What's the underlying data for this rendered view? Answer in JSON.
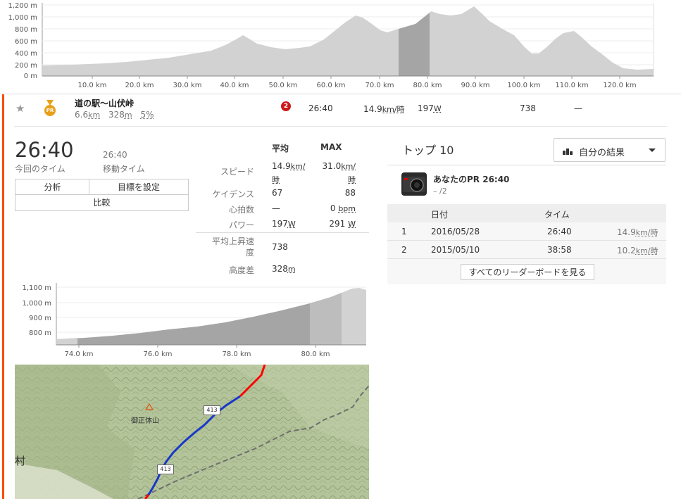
{
  "elevation_top": {
    "y_ticks": [
      "1,200 m",
      "1,000 m",
      "800 m",
      "600 m",
      "400 m",
      "200 m",
      "0 m"
    ],
    "x_ticks": [
      "10.0 km",
      "20.0 km",
      "30.0 km",
      "40.0 km",
      "50.0 km",
      "60.0 km",
      "70.0 km",
      "80.0 km",
      "90.0 km",
      "100.0 km",
      "110.0 km",
      "120.0 km"
    ]
  },
  "segment_row": {
    "star": "★",
    "pr_badge": "PR",
    "name": "道の駅～山伏峠",
    "distance": "6.6",
    "distance_unit": "km",
    "elev_gain": "328",
    "elev_unit": "m",
    "grade": "5%",
    "rank_badge": "2",
    "time": "26:40",
    "speed": "14.9",
    "speed_unit": "km/時",
    "power": "197",
    "power_unit": "W",
    "climb": "738",
    "dash": "—"
  },
  "effort": {
    "time": "26:40",
    "time_label": "今回のタイム",
    "moving_time": "26:40",
    "moving_label": "移動タイム",
    "btn_analysis": "分析",
    "btn_goal": "目標を設定",
    "btn_compare": "比較"
  },
  "stats": {
    "avg_header": "平均",
    "max_header": "MAX",
    "rows": [
      {
        "label": "スピード",
        "avg": "14.9",
        "avg_unit": "km/時",
        "max": "31.0",
        "max_unit": "km/時"
      },
      {
        "label": "ケイデンス",
        "avg": "67",
        "avg_unit": "",
        "max": "88",
        "max_unit": ""
      },
      {
        "label": "心拍数",
        "avg": "—",
        "avg_unit": "",
        "max": "0",
        "max_unit": "bpm"
      },
      {
        "label": "パワー",
        "avg": "197",
        "avg_unit": "W",
        "max": "291",
        "max_unit": "W"
      }
    ],
    "vam_label_1": "平均上昇速",
    "vam_label_2": "度",
    "vam_value": "738",
    "elev_label": "高度差",
    "elev_value": "328",
    "elev_unit": "m"
  },
  "elevation_small": {
    "y_ticks": [
      "1,100 m",
      "1,000 m",
      "900 m",
      "800 m"
    ],
    "x_ticks": [
      "74.0 km",
      "76.0 km",
      "78.0 km",
      "80.0 km"
    ]
  },
  "map": {
    "peak_label": "御正体山",
    "road_label_1": "413",
    "road_label_2": "413",
    "edge_label": "村"
  },
  "leaderboard": {
    "title": "トップ 10",
    "filter": "自分の結果",
    "pr_title": "あなたのPR 26:40",
    "pr_rank": "– /2",
    "col_date": "日付",
    "col_time": "タイム",
    "rows": [
      {
        "rank": "1",
        "date": "2016/05/28",
        "time": "26:40",
        "speed": "14.9",
        "unit": "km/時"
      },
      {
        "rank": "2",
        "date": "2015/05/10",
        "time": "38:58",
        "speed": "10.2",
        "unit": "km/時"
      }
    ],
    "view_all": "すべてのリーダーボードを見る"
  },
  "colors": {
    "accent_orange": "#fc4c02",
    "pr_gold": "#e8a01a",
    "rank_red": "#cc1a1a",
    "route_red": "#ff0000",
    "route_blue": "#1838c8",
    "chart_fill": "#d2d2d2",
    "chart_highlight": "#a5a5a5"
  }
}
